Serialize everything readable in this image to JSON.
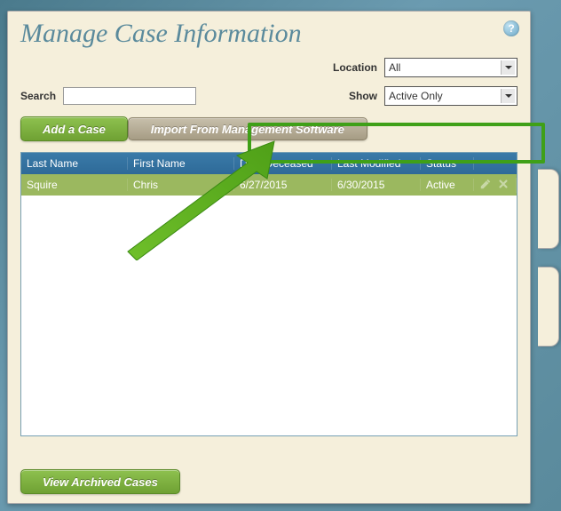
{
  "page": {
    "title": "Manage Case Information"
  },
  "filters": {
    "location_label": "Location",
    "location_value": "All",
    "show_label": "Show",
    "show_value": "Active Only",
    "search_label": "Search",
    "search_value": ""
  },
  "buttons": {
    "add_case": "Add a Case",
    "import": "Import From Management Software",
    "view_archived": "View Archived Cases"
  },
  "table": {
    "headers": {
      "last_name": "Last Name",
      "first_name": "First Name",
      "date_deceased": "Date Deceased",
      "last_modified": "Last Modified",
      "status": "Status"
    },
    "rows": [
      {
        "last_name": "Squire",
        "first_name": "Chris",
        "date_deceased": "6/27/2015",
        "last_modified": "6/30/2015",
        "status": "Active"
      }
    ]
  },
  "help": "?"
}
